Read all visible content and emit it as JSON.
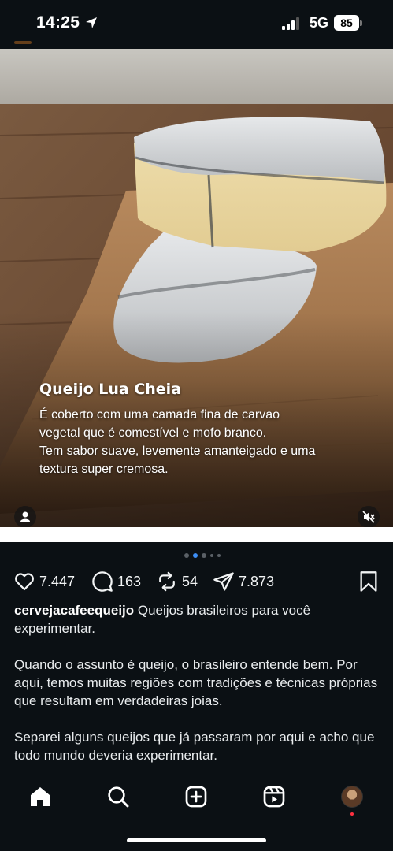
{
  "status_bar": {
    "time": "14:25",
    "network": "5G",
    "battery": "85"
  },
  "post": {
    "overlay_title": "Queijo Lua Cheia",
    "overlay_lines": [
      "É coberto com uma camada fina de carvao",
      "vegetal que é comestível e mofo branco.",
      "Tem sabor suave, levemente amanteigado e uma",
      "textura super cremosa."
    ],
    "carousel": {
      "total_dots": 5,
      "active_index": 1
    }
  },
  "actions": {
    "likes": "7.447",
    "comments": "163",
    "reposts": "54",
    "shares": "7.873"
  },
  "caption": {
    "username": "cervejacafeequeijo",
    "text": " Queijos brasileiros para você experimentar.",
    "paragraph_2": "Quando o assunto é queijo, o brasileiro entende bem. Por aqui, temos muitas regiões com tradições e técnicas próprias que resultam em verdadeiras joias.",
    "paragraph_3": "Separei alguns queijos que já passaram por aqui e acho que todo mundo deveria experimentar."
  },
  "nav": {
    "items": [
      "home-icon",
      "search-icon",
      "create-icon",
      "reels-icon",
      "profile-avatar"
    ]
  },
  "colors": {
    "background": "#0b1014",
    "accent": "#3d8ef5",
    "notification": "#ff3040"
  }
}
